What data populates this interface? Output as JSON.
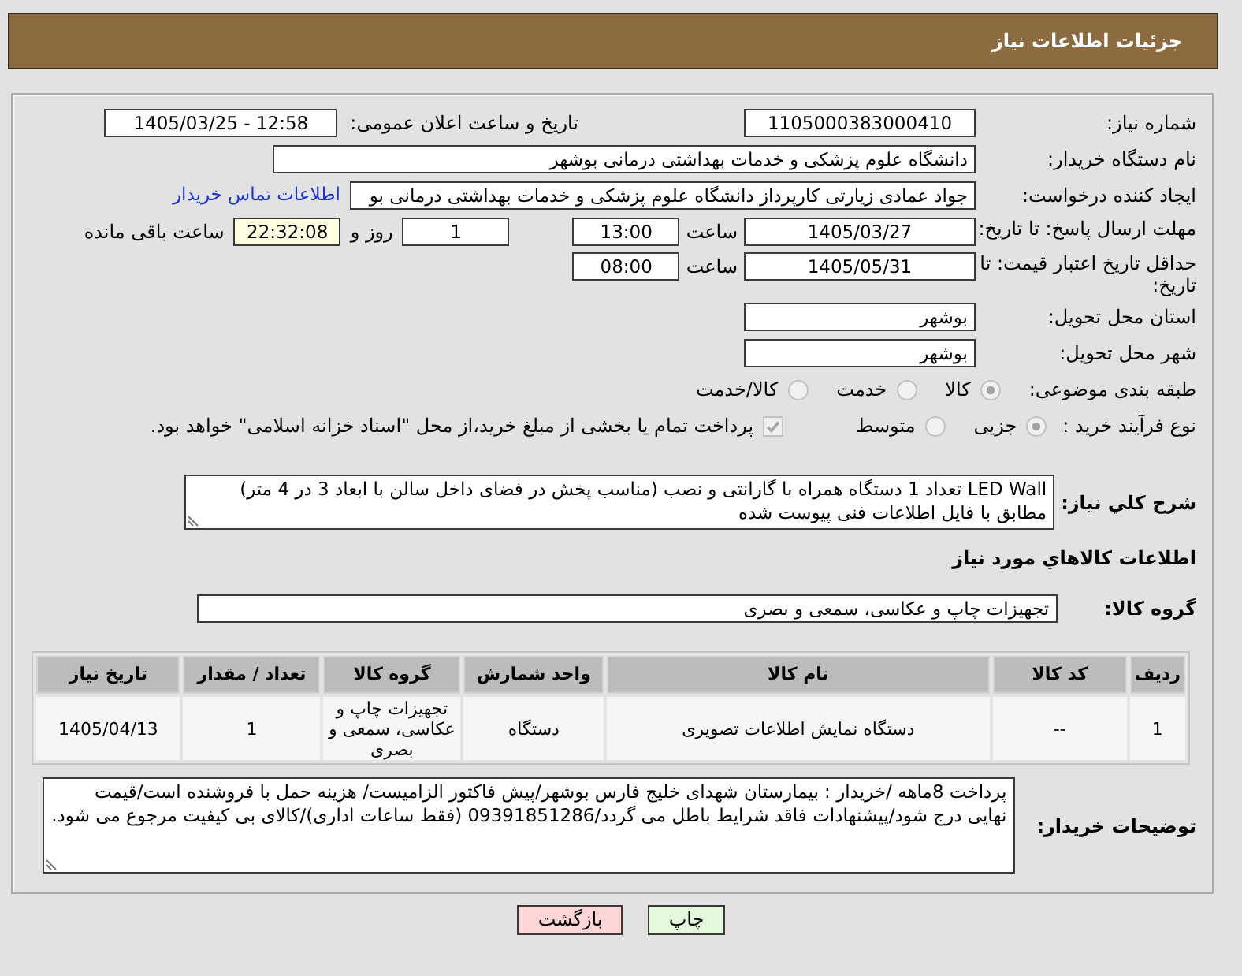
{
  "header": {
    "title": "جزئیات اطلاعات نیاز"
  },
  "need_number": {
    "label": "شماره نیاز:",
    "value": "1105000383000410"
  },
  "announcement": {
    "label": "تاریخ و ساعت اعلان عمومی:",
    "value": "1405/03/25 - 12:58"
  },
  "buyer_org": {
    "label": "نام دستگاه خریدار:",
    "value": "دانشگاه علوم پزشکی و خدمات بهداشتی درمانی بوشهر"
  },
  "requester": {
    "label": "ایجاد کننده درخواست:",
    "value": "جواد عمادی زیارتی کارپرداز دانشگاه علوم پزشکی و خدمات بهداشتی درمانی بو",
    "contact_link": "اطلاعات تماس خریدار"
  },
  "reply_deadline": {
    "label": "مهلت ارسال پاسخ: تا تاریخ:",
    "date": "1405/03/27",
    "time_label": "ساعت",
    "time": "13:00",
    "days": "1",
    "days_label": "روز و",
    "remaining": "22:32:08",
    "remaining_label": "ساعت باقی مانده"
  },
  "price_validity": {
    "label": "حداقل تاریخ اعتبار قیمت: تا تاریخ:",
    "date": "1405/05/31",
    "time_label": "ساعت",
    "time": "08:00"
  },
  "delivery_province": {
    "label": "استان محل تحویل:",
    "value": "بوشهر"
  },
  "delivery_city": {
    "label": "شهر محل تحویل:",
    "value": "بوشهر"
  },
  "category": {
    "label": "طبقه بندی موضوعی:",
    "options": [
      {
        "label": "کالا",
        "selected": true,
        "disabled": true
      },
      {
        "label": "خدمت",
        "selected": false,
        "disabled": true
      },
      {
        "label": "کالا/خدمت",
        "selected": false,
        "disabled": true
      }
    ]
  },
  "process_type": {
    "label": "نوع فرآیند خرید :",
    "options": [
      {
        "label": "جزیی",
        "selected": true,
        "disabled": true
      },
      {
        "label": "متوسط",
        "selected": false,
        "disabled": true
      }
    ],
    "treasury_payment": {
      "label": "پرداخت تمام یا بخشی از مبلغ خرید،از محل \"اسناد خزانه اسلامی\" خواهد بود.",
      "checked": true,
      "disabled": true
    }
  },
  "description": {
    "label": "شرح کلي نياز:",
    "value": "LED Wall تعداد 1 دستگاه همراه با گارانتی و نصب (مناسب پخش در فضای داخل سالن با ابعاد 3 در 4 متر) مطابق با فایل اطلاعات فنی پیوست شده"
  },
  "goods": {
    "title": "اطلاعات کالاهاي مورد نياز",
    "group_label": "گروه کالا:",
    "group_value": "تجهیزات چاپ و عکاسی، سمعی و بصری",
    "table": {
      "columns": [
        "ردیف",
        "کد کالا",
        "نام کالا",
        "واحد شمارش",
        "گروه کالا",
        "تعداد / مقدار",
        "تاریخ نیاز"
      ],
      "rows": [
        [
          "1",
          "--",
          "دستگاه نمایش اطلاعات تصویری",
          "دستگاه",
          "تجهیزات چاپ و عکاسی، سمعی و بصری",
          "1",
          "1405/04/13"
        ]
      ]
    }
  },
  "buyer_notes": {
    "label": "توضیحات خریدار:",
    "value": "پرداخت 8ماهه /خریدار : بیمارستان شهدای خلیج فارس بوشهر/پیش فاکتور الزامیست/ هزینه حمل با فروشنده است/قیمت نهایی درج شود/پیشنهادات فاقد شرایط باطل می گردد/09391851286 (فقط ساعات اداری)/کالای بی کیفیت مرجوع می شود."
  },
  "buttons": [
    {
      "label": "چاپ",
      "kind": "print"
    },
    {
      "label": "بازگشت",
      "kind": "back"
    }
  ]
}
